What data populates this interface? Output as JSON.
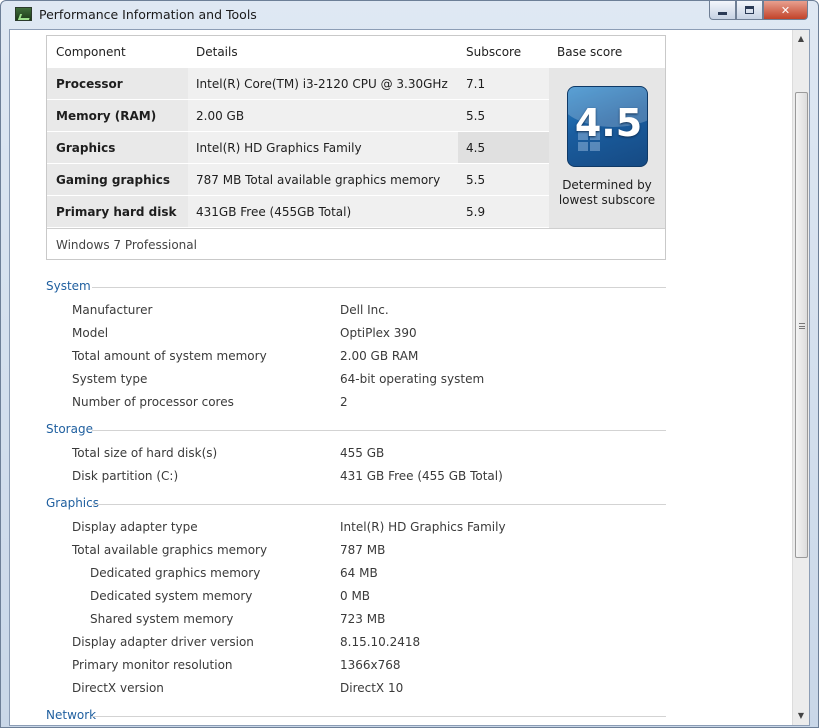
{
  "window": {
    "title": "Performance Information and Tools",
    "minimize_icon": "minimize-icon",
    "maximize_icon": "maximize-icon",
    "close_glyph": "✕"
  },
  "score_table": {
    "headers": {
      "component": "Component",
      "details": "Details",
      "subscore": "Subscore",
      "base_score": "Base score"
    },
    "rows": [
      {
        "component": "Processor",
        "details": "Intel(R) Core(TM) i3-2120 CPU @ 3.30GHz",
        "subscore": "7.1"
      },
      {
        "component": "Memory (RAM)",
        "details": "2.00 GB",
        "subscore": "5.5"
      },
      {
        "component": "Graphics",
        "details": "Intel(R) HD Graphics Family",
        "subscore": "4.5"
      },
      {
        "component": "Gaming graphics",
        "details": "787 MB Total available graphics memory",
        "subscore": "5.5"
      },
      {
        "component": "Primary hard disk",
        "details": "431GB Free (455GB Total)",
        "subscore": "5.9"
      }
    ],
    "base_score": "4.5",
    "base_caption_line1": "Determined by",
    "base_caption_line2": "lowest subscore",
    "os_edition": "Windows 7 Professional",
    "badge_color": "#1a5d9f"
  },
  "system": {
    "title": "System",
    "rows": [
      {
        "label": "Manufacturer",
        "value": "Dell Inc."
      },
      {
        "label": "Model",
        "value": "OptiPlex 390"
      },
      {
        "label": "Total amount of system memory",
        "value": "2.00 GB RAM"
      },
      {
        "label": "System type",
        "value": "64-bit operating system"
      },
      {
        "label": "Number of processor cores",
        "value": "2"
      }
    ]
  },
  "storage": {
    "title": "Storage",
    "rows": [
      {
        "label": "Total size of hard disk(s)",
        "value": "455 GB"
      },
      {
        "label": "Disk partition (C:)",
        "value": "431 GB Free (455 GB Total)"
      }
    ]
  },
  "graphics": {
    "title": "Graphics",
    "rows": [
      {
        "label": "Display adapter type",
        "value": "Intel(R) HD Graphics Family"
      },
      {
        "label": "Total available graphics memory",
        "value": "787 MB"
      },
      {
        "label": "Dedicated graphics memory",
        "value": "64 MB"
      },
      {
        "label": "Dedicated system memory",
        "value": "0 MB"
      },
      {
        "label": "Shared system memory",
        "value": "723 MB"
      },
      {
        "label": "Display adapter driver version",
        "value": "8.15.10.2418"
      },
      {
        "label": "Primary monitor resolution",
        "value": "1366x768"
      },
      {
        "label": "DirectX version",
        "value": "DirectX 10"
      }
    ]
  },
  "network": {
    "title": "Network"
  },
  "colors": {
    "section_title": "#1f5f9f",
    "title_bar": "#c9d7e8"
  }
}
